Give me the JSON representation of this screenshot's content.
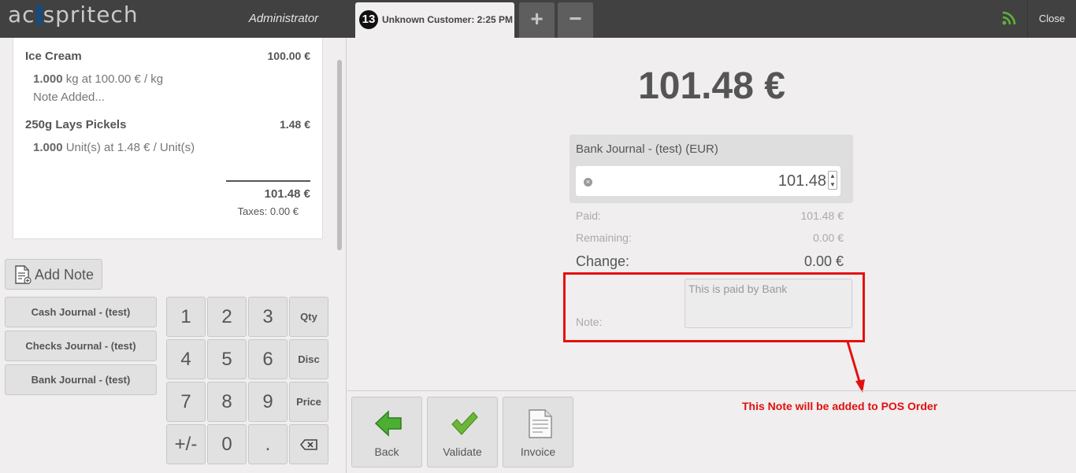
{
  "header": {
    "logo_text": "acespritech",
    "user": "Administrator",
    "order_tab": {
      "number": "13",
      "label": "Unknown Customer: 2:25 PM"
    },
    "add_label": "+",
    "remove_label": "−",
    "close_label": "Close"
  },
  "order": {
    "lines": [
      {
        "name": "Ice Cream",
        "price": "100.00 €",
        "qty": "1.000",
        "detail": "kg at 100.00 € / kg",
        "note": "Note Added..."
      },
      {
        "name": "250g Lays Pickels",
        "price": "1.48 €",
        "qty": "1.000",
        "detail": "Unit(s) at 1.48 € / Unit(s)"
      }
    ],
    "total": "101.48 €",
    "taxes": "Taxes: 0.00 €"
  },
  "add_note_label": "Add Note",
  "paymethods": [
    "Cash Journal - (test)",
    "Checks Journal - (test)",
    "Bank Journal - (test)"
  ],
  "numpad": {
    "k1": "1",
    "k2": "2",
    "k3": "3",
    "qty": "Qty",
    "k4": "4",
    "k5": "5",
    "k6": "6",
    "disc": "Disc",
    "k7": "7",
    "k8": "8",
    "k9": "9",
    "price": "Price",
    "sign": "+/-",
    "k0": "0",
    "dot": "."
  },
  "payment": {
    "due": "101.48 €",
    "journal_title": "Bank Journal - (test) (EUR)",
    "input_value": "101.48",
    "paid_label": "Paid:",
    "paid_value": "101.48 €",
    "remaining_label": "Remaining:",
    "remaining_value": "0.00 €",
    "change_label": "Change:",
    "change_value": "0.00 €",
    "note_label": "Note:",
    "note_value": "This is paid by Bank"
  },
  "annotation": "This Note will be added to POS Order",
  "actions": {
    "back": "Back",
    "validate": "Validate",
    "invoice": "Invoice"
  },
  "colors": {
    "header_bg": "#414141",
    "annotation_red": "#e41010",
    "validate_green": "#6cb63a",
    "back_green": "#4caf34",
    "rss_green": "#5fb336"
  }
}
